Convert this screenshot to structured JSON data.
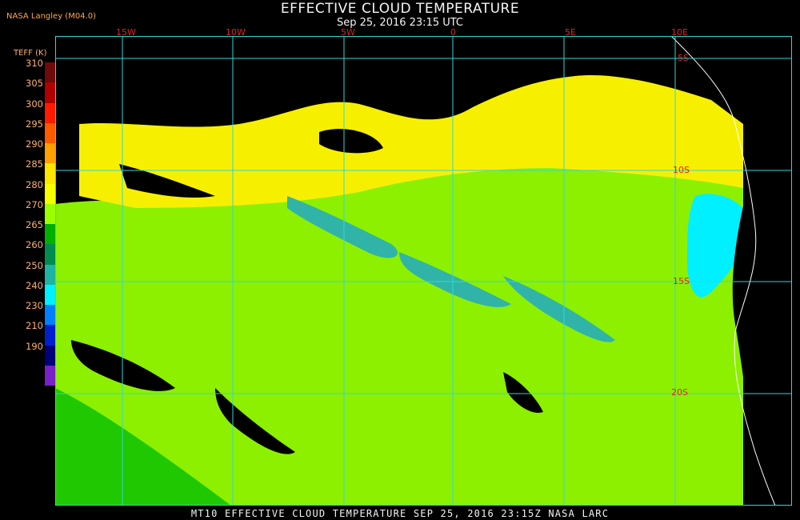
{
  "header": {
    "title": "EFFECTIVE CLOUD TEMPERATURE",
    "subtitle": "Sep 25, 2016 23:15 UTC",
    "producer": "NASA Langley (M04.0)"
  },
  "legend": {
    "title": "TEFF (K)",
    "ticks": [
      "310",
      "305",
      "300",
      "295",
      "290",
      "285",
      "280",
      "270",
      "265",
      "260",
      "250",
      "240",
      "230",
      "210",
      "190"
    ],
    "colors": [
      "#6e0a0a",
      "#b00000",
      "#ff1a00",
      "#ff5a00",
      "#ff9f00",
      "#ffe600",
      "#f6ff00",
      "#9cff00",
      "#00b000",
      "#008c50",
      "#1fb3a6",
      "#00f0ff",
      "#0080ff",
      "#0020d0",
      "#00007a",
      "#7a20c8"
    ]
  },
  "map": {
    "lon_labels": [
      "15W",
      "10W",
      "5W",
      "0",
      "5E",
      "10E"
    ],
    "lat_labels": [
      "5S",
      "10S",
      "15S",
      "20S"
    ]
  },
  "footer": {
    "text": "MT10  EFFECTIVE CLOUD TEMPERATURE   SEP 25, 2016 23:15Z   NASA LARC"
  }
}
